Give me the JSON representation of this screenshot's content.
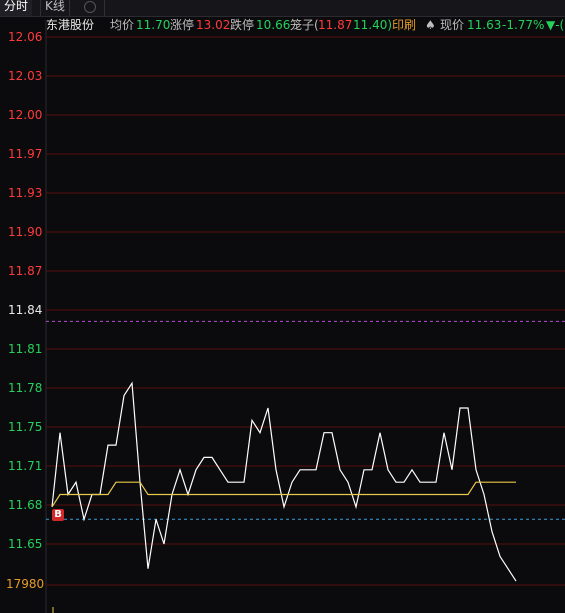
{
  "tabs": {
    "intraday": "分时",
    "kline": "K线",
    "history_icon": "clock-icon"
  },
  "header": {
    "stock_name": "东港股份",
    "avg_label": "均价",
    "avg_value": "11.70",
    "limit_up_label": "涨停",
    "limit_up_value": "13.02",
    "limit_down_label": "跌停",
    "limit_down_value": "10.66",
    "bid_ask_label": "笼子(",
    "bid_value": "11.87",
    "ask_value": "11.40)",
    "print_label": "印刷",
    "current_label": "现价",
    "current_value": "11.63",
    "change_value": "-1.77%",
    "trend_arrow": "▼-("
  },
  "colors": {
    "up": "#ff3b3b",
    "down": "#25d15a",
    "price_line": "#ffffff",
    "avg_line": "#e8c84a",
    "grid": "#5a0f0f",
    "ref_purple": "#b84bd6",
    "ref_cyan": "#3aa0d8"
  },
  "badge": "B",
  "volume_label": "17980",
  "chart_data": {
    "type": "line",
    "y_ticks": [
      "12.06",
      "12.03",
      "12.00",
      "11.97",
      "11.93",
      "11.90",
      "11.87",
      "11.84",
      "11.81",
      "11.78",
      "11.75",
      "11.71",
      "11.68",
      "11.65"
    ],
    "ylim": [
      11.63,
      12.06
    ],
    "x_range": [
      0,
      60
    ],
    "series": [
      {
        "role": "price",
        "values": [
          11.68,
          11.74,
          11.69,
          11.7,
          11.67,
          11.69,
          11.69,
          11.73,
          11.73,
          11.77,
          11.78,
          11.7,
          11.63,
          11.67,
          11.65,
          11.69,
          11.71,
          11.69,
          11.71,
          11.72,
          11.72,
          11.71,
          11.7,
          11.7,
          11.7,
          11.75,
          11.74,
          11.76,
          11.71,
          11.68,
          11.7,
          11.71,
          11.71,
          11.71,
          11.74,
          11.74,
          11.71,
          11.7,
          11.68,
          11.71,
          11.71,
          11.74,
          11.71,
          11.7,
          11.7,
          11.71,
          11.7,
          11.7,
          11.7,
          11.74,
          11.71,
          11.76,
          11.76,
          11.71,
          11.69,
          11.66,
          11.64,
          11.63,
          11.62
        ]
      },
      {
        "role": "average",
        "values": [
          11.68,
          11.69,
          11.69,
          11.69,
          11.69,
          11.69,
          11.69,
          11.69,
          11.7,
          11.7,
          11.7,
          11.7,
          11.69,
          11.69,
          11.69,
          11.69,
          11.69,
          11.69,
          11.69,
          11.69,
          11.69,
          11.69,
          11.69,
          11.69,
          11.69,
          11.69,
          11.69,
          11.69,
          11.69,
          11.69,
          11.69,
          11.69,
          11.69,
          11.69,
          11.69,
          11.69,
          11.69,
          11.69,
          11.69,
          11.69,
          11.69,
          11.69,
          11.69,
          11.69,
          11.69,
          11.69,
          11.69,
          11.69,
          11.69,
          11.69,
          11.69,
          11.69,
          11.69,
          11.7,
          11.7,
          11.7,
          11.7,
          11.7,
          11.7
        ]
      }
    ],
    "reference_lines": [
      {
        "value": 11.83,
        "color": "#b84bd6"
      },
      {
        "value": 11.67,
        "color": "#3aa0d8"
      }
    ]
  }
}
